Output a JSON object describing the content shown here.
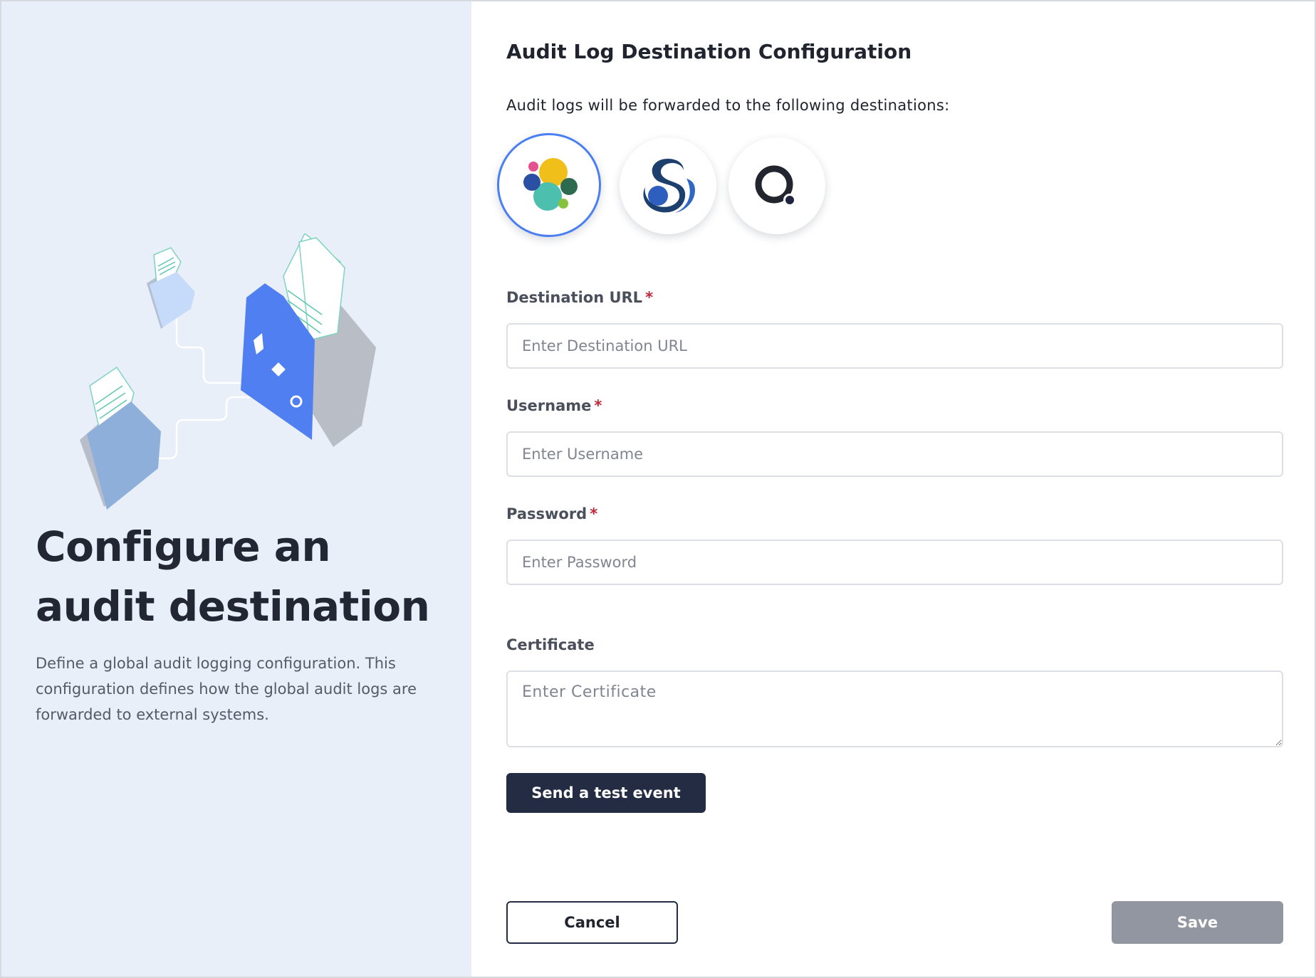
{
  "left_panel": {
    "title": "Configure an audit destination",
    "description": "Define a global audit logging configuration. This configuration defines how the global audit logs are forwarded to external systems."
  },
  "form": {
    "title": "Audit Log Destination Configuration",
    "destinations_intro": "Audit logs will be forwarded to the following destinations:",
    "destinations": [
      {
        "icon": "elastic-logo-icon",
        "selected": true
      },
      {
        "icon": "splunk-logo-icon",
        "selected": false
      },
      {
        "icon": "qradar-logo-icon",
        "selected": false
      }
    ],
    "fields": {
      "destination_url": {
        "label": "Destination URL",
        "required_mark": "*",
        "placeholder": "Enter Destination URL",
        "value": ""
      },
      "username": {
        "label": "Username",
        "required_mark": "*",
        "placeholder": "Enter Username",
        "value": ""
      },
      "password": {
        "label": "Password",
        "required_mark": "*",
        "placeholder": "Enter Password",
        "value": ""
      },
      "certificate": {
        "label": "Certificate",
        "placeholder": "Enter Certificate",
        "value": ""
      }
    },
    "test_button_label": "Send a test event",
    "cancel_label": "Cancel",
    "save_label": "Save"
  },
  "colors": {
    "left_bg": "#e8eff9",
    "primary_dark": "#232c43",
    "selected_ring": "#4a7ff2",
    "required": "#c0263a",
    "save_disabled": "#9196a0"
  }
}
